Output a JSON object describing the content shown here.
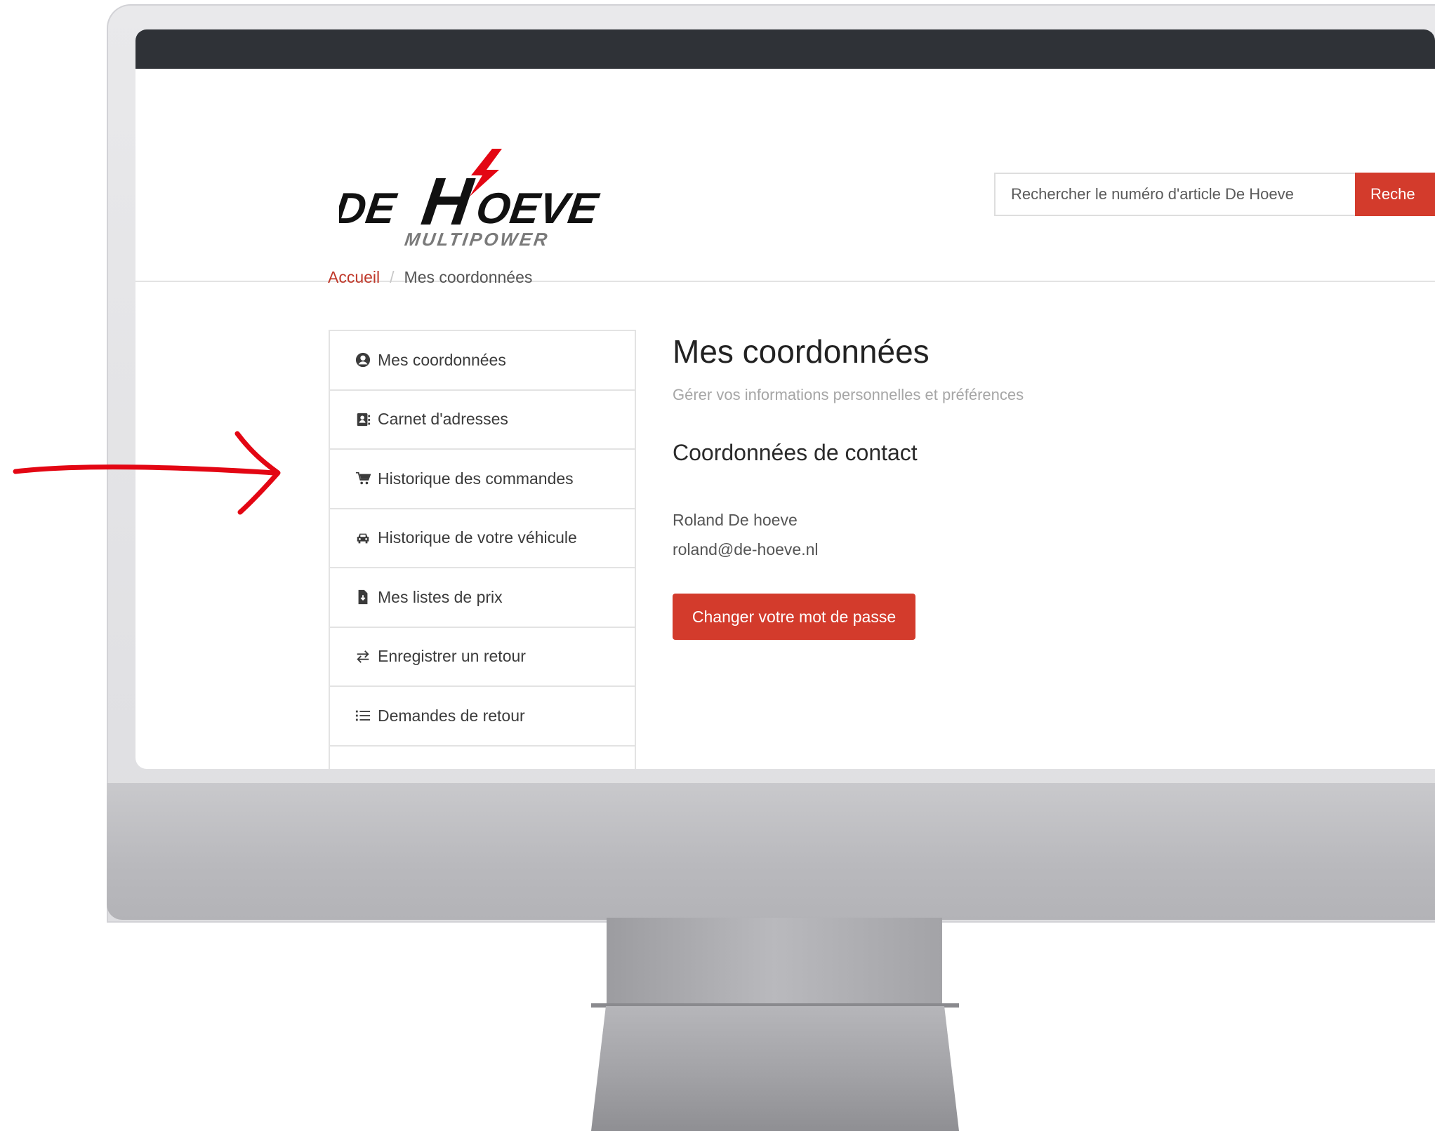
{
  "logo": {
    "name": "DE HOEVE",
    "tagline": "MULTIPOWER"
  },
  "header": {
    "search_placeholder": "Rechercher le numéro d'article De Hoeve",
    "search_button": "Reche"
  },
  "breadcrumb": {
    "home": "Accueil",
    "separator": "/",
    "current": "Mes coordonnées"
  },
  "sidebar": {
    "items": [
      {
        "label": "Mes coordonnées",
        "icon": "user-circle-icon"
      },
      {
        "label": "Carnet d'adresses",
        "icon": "address-book-icon"
      },
      {
        "label": "Historique des commandes",
        "icon": "cart-icon"
      },
      {
        "label": "Historique de votre véhicule",
        "icon": "car-icon"
      },
      {
        "label": "Mes listes de prix",
        "icon": "file-download-icon"
      },
      {
        "label": "Enregistrer un retour",
        "icon": "exchange-icon"
      },
      {
        "label": "Demandes de retour",
        "icon": "list-icon"
      }
    ]
  },
  "main": {
    "title": "Mes coordonnées",
    "subtitle": "Gérer vos informations personnelles et préférences",
    "contact_section_title": "Coordonnées de contact",
    "contact_name": "Roland De hoeve",
    "contact_email": "roland@de-hoeve.nl",
    "change_password_button": "Changer votre mot de passe"
  },
  "colors": {
    "accent": "#d33b2c",
    "topbar": "#2f3237",
    "annotation_arrow": "#e30613"
  }
}
